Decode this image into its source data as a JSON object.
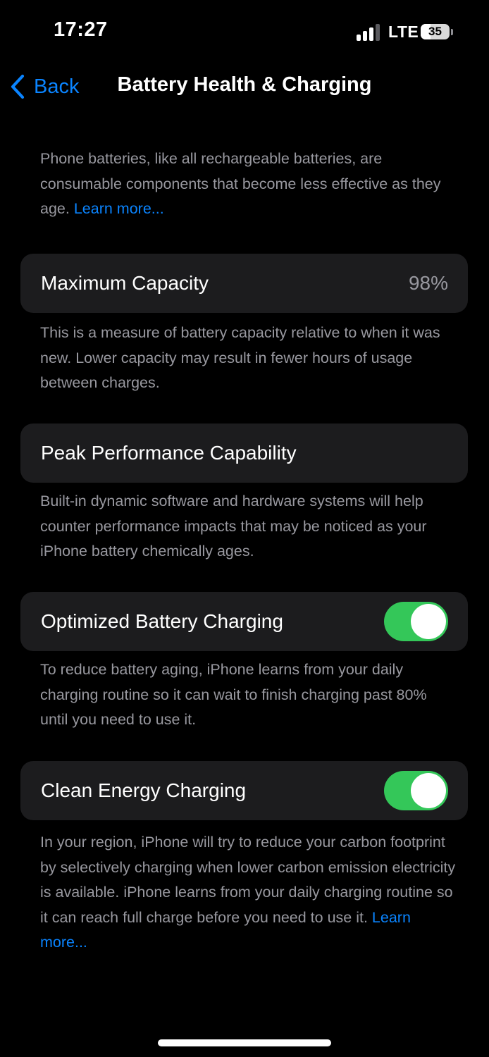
{
  "status_bar": {
    "time": "17:27",
    "network": "LTE",
    "battery_percent": "35",
    "battery_level": 0.35,
    "signal_bars_active": 3,
    "signal_bars_total": 4
  },
  "nav": {
    "back_label": "Back",
    "title": "Battery Health & Charging",
    "back_icon": "chevron-left-icon"
  },
  "intro": {
    "text": "Phone batteries, like all rechargeable batteries, are consumable components that become less effective as they age.",
    "link": "Learn more..."
  },
  "max_capacity": {
    "label": "Maximum Capacity",
    "value": "98%",
    "footer": "This is a measure of battery capacity relative to when it was new. Lower capacity may result in fewer hours of usage between charges."
  },
  "peak_performance": {
    "label": "Peak Performance Capability",
    "footer": "Built-in dynamic software and hardware systems will help counter performance impacts that may be noticed as your iPhone battery chemically ages."
  },
  "optimized_charging": {
    "label": "Optimized Battery Charging",
    "enabled": true,
    "footer": "To reduce battery aging, iPhone learns from your daily charging routine so it can wait to finish charging past 80% until you need to use it."
  },
  "clean_energy": {
    "label": "Clean Energy Charging",
    "enabled": true,
    "footer": "In your region, iPhone will try to reduce your carbon footprint by selectively charging when lower carbon emission electricity is available. iPhone learns from your daily charging routine so it can reach full charge before you need to use it.",
    "link": "Learn more..."
  },
  "colors": {
    "background": "#000000",
    "cell": "#1c1c1e",
    "accent": "#0a84ff",
    "toggle_on": "#34c759",
    "secondary_text": "#98989f"
  }
}
